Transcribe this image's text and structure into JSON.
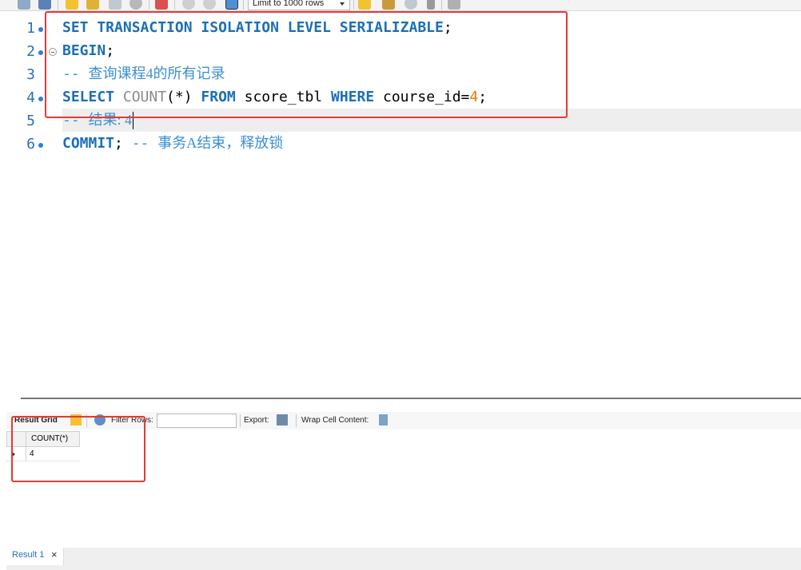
{
  "toolbar": {
    "limit_select": "Limit to 1000 rows",
    "icons": [
      "folder-icon",
      "save-icon",
      "execute-icon",
      "execute-current-icon",
      "explain-icon",
      "stop-icon",
      "toggle-error-icon",
      "commit-icon",
      "rollback-icon",
      "autocommit-icon",
      "bookmark-icon",
      "beautify-icon",
      "find-icon",
      "invisible-chars-icon",
      "wrap-icon"
    ]
  },
  "editor": {
    "line_numbers": [
      "1",
      "2",
      "3",
      "4",
      "5",
      "6"
    ],
    "lines": [
      {
        "kw1": "SET TRANSACTION ISOLATION LEVEL SERIALIZABLE",
        "punct": ";"
      },
      {
        "kw1": "BEGIN",
        "punct": ";"
      },
      {
        "dash": "-- ",
        "comment": "查询课程4的所有记录"
      },
      {
        "kw1": "SELECT ",
        "fn": "COUNT",
        "p1": "(*) ",
        "kw2": "FROM",
        "plain": " score_tbl ",
        "kw3": "WHERE",
        "plain2": " course_id=",
        "num": "4",
        "punct": ";"
      },
      {
        "dash": "-- ",
        "comment": "结果: 4"
      },
      {
        "kw1": "COMMIT",
        "punct": "; ",
        "dash": "-- ",
        "comment": "事务A结束，释放锁"
      }
    ]
  },
  "result_panel": {
    "tab_label": "Result Grid",
    "filter_label": "Filter Rows:",
    "filter_value": "",
    "export_label": "Export:",
    "wrap_label": "Wrap Cell Content:",
    "columns": [
      "COUNT(*)"
    ],
    "rows": [
      [
        "4"
      ]
    ]
  },
  "bottom_tabs": [
    {
      "label": "Result 1",
      "close": "×"
    }
  ],
  "colors": {
    "keyword": "#1b6fb8",
    "comment": "#3b8fd3",
    "number": "#e07b00",
    "annotation": "#e53935"
  }
}
